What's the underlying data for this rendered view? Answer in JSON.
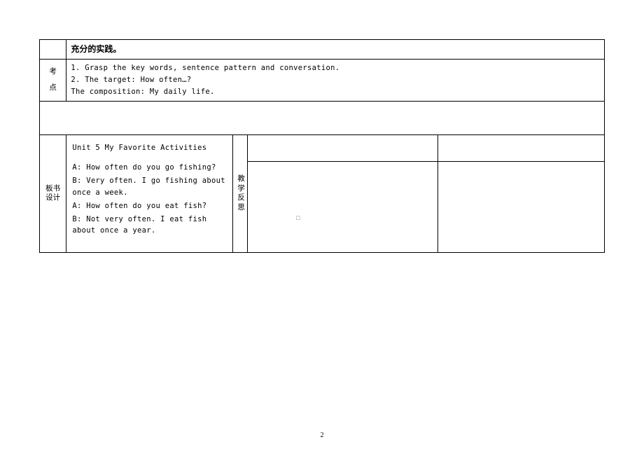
{
  "row1": {
    "text": "充分的实践。"
  },
  "row2": {
    "label_line1": "考",
    "label_line2": "点",
    "line1": "1. Grasp the key words, sentence pattern and conversation.",
    "line2": "2. The target: How often…?",
    "line3": "The composition: My daily life."
  },
  "row4": {
    "label_line1": "板书",
    "label_line2": "设计",
    "title": "Unit 5 My Favorite Activities",
    "dlg1": "A: How often do you go fishing?",
    "dlg2": "B: Very often. I go fishing about once a week.",
    "dlg3": "A: How often do you eat fish?",
    "dlg4": "B: Not very often. I eat fish about once a year.",
    "reflect_c1": "教",
    "reflect_c2": "学",
    "reflect_c3": "反",
    "reflect_c4": "思"
  },
  "page_number": "2",
  "center_marker": "□"
}
